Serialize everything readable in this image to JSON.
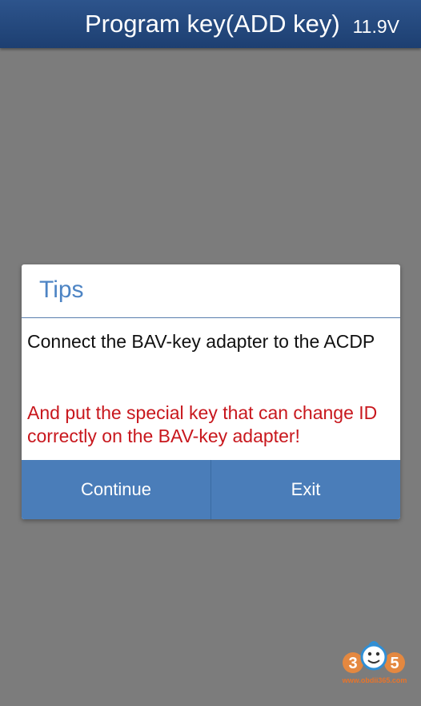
{
  "header": {
    "title": "Program key(ADD key)",
    "voltage": "11.9V"
  },
  "dialog": {
    "title": "Tips",
    "message": "Connect the BAV-key adapter to the ACDP",
    "warning": "And put the special key that can change ID correctly on the BAV-key adapter!",
    "buttons": {
      "continue": "Continue",
      "exit": "Exit"
    }
  },
  "watermark": {
    "logo_text": "365",
    "url": "www.obdii365.com"
  },
  "colors": {
    "header": "#1d3f71",
    "backdrop": "#7c7c7c",
    "accent": "#4d84c4",
    "button": "#4a7db9",
    "warning": "#c8171d"
  }
}
